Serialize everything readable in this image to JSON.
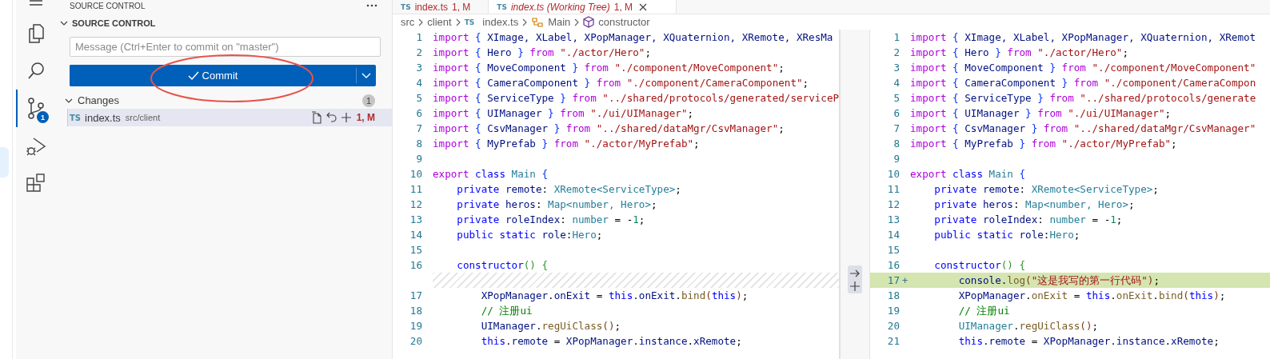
{
  "activity_bar": {
    "items": [
      {
        "kind": "menu",
        "selected": false
      },
      {
        "kind": "files",
        "selected": false
      },
      {
        "kind": "search",
        "selected": false
      },
      {
        "kind": "source-control",
        "selected": true,
        "badge": "1"
      },
      {
        "kind": "run-debug",
        "selected": false
      },
      {
        "kind": "extensions",
        "selected": false
      }
    ]
  },
  "sidebar": {
    "title": "SOURCE CONTROL",
    "section": {
      "label": "SOURCE CONTROL",
      "expanded": true
    },
    "message": {
      "placeholder": "Message (Ctrl+Enter to commit on \"master\")"
    },
    "commit_button": {
      "label": "Commit"
    },
    "annotation": {
      "kind": "ellipse"
    },
    "changes": {
      "label": "Changes",
      "expanded": true,
      "count": "1",
      "files": [
        {
          "file_type": "TS",
          "name": "index.ts",
          "path": "src/client",
          "status": "1, M",
          "selected": true
        }
      ]
    }
  },
  "editor": {
    "tabs": [
      {
        "file_type": "TS",
        "label": "index.ts",
        "status": "1, M",
        "selected": false,
        "preview": false
      },
      {
        "file_type": "TS",
        "label": "index.ts (Working Tree)",
        "status": "1, M",
        "selected": true,
        "preview": true
      }
    ],
    "breadcrumbs": [
      {
        "label": "src",
        "kind": "folder"
      },
      {
        "label": "client",
        "kind": "folder"
      },
      {
        "label": "index.ts",
        "kind": "ts-file",
        "file_type": "TS"
      },
      {
        "label": "Main",
        "kind": "class"
      },
      {
        "label": "constructor",
        "kind": "method"
      }
    ],
    "left_pane": {
      "lines": [
        {
          "kind": "line",
          "number": "1",
          "tokens": [
            {
              "kind": "k",
              "text": "import "
            },
            {
              "kind": "b1",
              "text": "{"
            },
            {
              "kind": "v",
              "text": " XImage, XLabel, XPopManager, XQuaternion, XRemote, XResMa"
            }
          ]
        },
        {
          "kind": "line",
          "number": "2",
          "tokens": [
            {
              "kind": "k",
              "text": "import "
            },
            {
              "kind": "b1",
              "text": "{"
            },
            {
              "kind": "v",
              "text": " Hero "
            },
            {
              "kind": "b1",
              "text": "}"
            },
            {
              "kind": "k",
              "text": " from "
            },
            {
              "kind": "s",
              "text": "\"./actor/Hero\""
            },
            {
              "kind": "p",
              "text": ";"
            }
          ]
        },
        {
          "kind": "line",
          "number": "3",
          "tokens": [
            {
              "kind": "k",
              "text": "import "
            },
            {
              "kind": "b1",
              "text": "{"
            },
            {
              "kind": "v",
              "text": " MoveComponent "
            },
            {
              "kind": "b1",
              "text": "}"
            },
            {
              "kind": "k",
              "text": " from "
            },
            {
              "kind": "s",
              "text": "\"./component/MoveComponent\""
            },
            {
              "kind": "p",
              "text": ";"
            }
          ]
        },
        {
          "kind": "line",
          "number": "4",
          "tokens": [
            {
              "kind": "k",
              "text": "import "
            },
            {
              "kind": "b1",
              "text": "{"
            },
            {
              "kind": "v",
              "text": " CameraComponent "
            },
            {
              "kind": "b1",
              "text": "}"
            },
            {
              "kind": "k",
              "text": " from "
            },
            {
              "kind": "s",
              "text": "\"./component/CameraComponent\""
            },
            {
              "kind": "p",
              "text": ";"
            }
          ]
        },
        {
          "kind": "line",
          "number": "5",
          "tokens": [
            {
              "kind": "k",
              "text": "import "
            },
            {
              "kind": "b1",
              "text": "{"
            },
            {
              "kind": "v",
              "text": " ServiceType "
            },
            {
              "kind": "b1",
              "text": "}"
            },
            {
              "kind": "k",
              "text": " from "
            },
            {
              "kind": "s",
              "text": "\"../shared/protocols/generated/serviceP"
            }
          ]
        },
        {
          "kind": "line",
          "number": "6",
          "tokens": [
            {
              "kind": "k",
              "text": "import "
            },
            {
              "kind": "b1",
              "text": "{"
            },
            {
              "kind": "v",
              "text": " UIManager "
            },
            {
              "kind": "b1",
              "text": "}"
            },
            {
              "kind": "k",
              "text": " from "
            },
            {
              "kind": "s",
              "text": "\"./ui/UIManager\""
            },
            {
              "kind": "p",
              "text": ";"
            }
          ]
        },
        {
          "kind": "line",
          "number": "7",
          "tokens": [
            {
              "kind": "k",
              "text": "import "
            },
            {
              "kind": "b1",
              "text": "{"
            },
            {
              "kind": "v",
              "text": " CsvManager "
            },
            {
              "kind": "b1",
              "text": "}"
            },
            {
              "kind": "k",
              "text": " from "
            },
            {
              "kind": "s",
              "text": "\"../shared/dataMgr/CsvManager\""
            },
            {
              "kind": "p",
              "text": ";"
            }
          ]
        },
        {
          "kind": "line",
          "number": "8",
          "tokens": [
            {
              "kind": "k",
              "text": "import "
            },
            {
              "kind": "b1",
              "text": "{"
            },
            {
              "kind": "v",
              "text": " MyPrefab "
            },
            {
              "kind": "b1",
              "text": "}"
            },
            {
              "kind": "k",
              "text": " from "
            },
            {
              "kind": "s",
              "text": "\"./actor/MyPrefab\""
            },
            {
              "kind": "p",
              "text": ";"
            }
          ]
        },
        {
          "kind": "line",
          "number": "9"
        },
        {
          "kind": "line",
          "number": "10",
          "tokens": [
            {
              "kind": "k",
              "text": "export "
            },
            {
              "kind": "b",
              "text": "class "
            },
            {
              "kind": "t",
              "text": "Main "
            },
            {
              "kind": "b1",
              "text": "{"
            }
          ]
        },
        {
          "kind": "line",
          "number": "11",
          "tokens": [
            {
              "kind": "b",
              "text": "    private "
            },
            {
              "kind": "v",
              "text": "remote"
            },
            {
              "kind": "p",
              "text": ": "
            },
            {
              "kind": "t",
              "text": "XRemote<ServiceType>"
            },
            {
              "kind": "p",
              "text": ";"
            }
          ]
        },
        {
          "kind": "line",
          "number": "12",
          "tokens": [
            {
              "kind": "b",
              "text": "    private "
            },
            {
              "kind": "v",
              "text": "heros"
            },
            {
              "kind": "p",
              "text": ": "
            },
            {
              "kind": "t",
              "text": "Map<number, Hero>"
            },
            {
              "kind": "p",
              "text": ";"
            }
          ]
        },
        {
          "kind": "line",
          "number": "13",
          "tokens": [
            {
              "kind": "b",
              "text": "    private "
            },
            {
              "kind": "v",
              "text": "roleIndex"
            },
            {
              "kind": "p",
              "text": ": "
            },
            {
              "kind": "t",
              "text": "number"
            },
            {
              "kind": "p",
              "text": " = -"
            },
            {
              "kind": "n",
              "text": "1"
            },
            {
              "kind": "p",
              "text": ";"
            }
          ]
        },
        {
          "kind": "line",
          "number": "14",
          "tokens": [
            {
              "kind": "b",
              "text": "    public static "
            },
            {
              "kind": "v",
              "text": "role"
            },
            {
              "kind": "p",
              "text": ":"
            },
            {
              "kind": "t",
              "text": "Hero"
            },
            {
              "kind": "p",
              "text": ";"
            }
          ]
        },
        {
          "kind": "line",
          "number": "15"
        },
        {
          "kind": "line",
          "number": "16",
          "tokens": [
            {
              "kind": "b",
              "text": "    constructor"
            },
            {
              "kind": "b2",
              "text": "() {"
            }
          ]
        },
        {
          "kind": "placeholder"
        },
        {
          "kind": "line",
          "number": "17",
          "tokens": [
            {
              "kind": "v",
              "text": "        XPopManager"
            },
            {
              "kind": "p",
              "text": "."
            },
            {
              "kind": "v",
              "text": "onExit"
            },
            {
              "kind": "p",
              "text": " = "
            },
            {
              "kind": "b",
              "text": "this"
            },
            {
              "kind": "p",
              "text": "."
            },
            {
              "kind": "v",
              "text": "onExit"
            },
            {
              "kind": "p",
              "text": "."
            },
            {
              "kind": "f",
              "text": "bind"
            },
            {
              "kind": "b3",
              "text": "("
            },
            {
              "kind": "b",
              "text": "this"
            },
            {
              "kind": "b3",
              "text": ")"
            },
            {
              "kind": "p",
              "text": ";"
            }
          ]
        },
        {
          "kind": "line",
          "number": "18",
          "tokens": [
            {
              "kind": "c",
              "text": "        // 注册ui"
            }
          ]
        },
        {
          "kind": "line",
          "number": "19",
          "tokens": [
            {
              "kind": "v",
              "text": "        UIManager"
            },
            {
              "kind": "p",
              "text": "."
            },
            {
              "kind": "f",
              "text": "regUiClass"
            },
            {
              "kind": "b3",
              "text": "()"
            },
            {
              "kind": "p",
              "text": ";"
            }
          ]
        },
        {
          "kind": "line",
          "number": "20",
          "tokens": [
            {
              "kind": "b",
              "text": "        this"
            },
            {
              "kind": "p",
              "text": "."
            },
            {
              "kind": "v",
              "text": "remote"
            },
            {
              "kind": "p",
              "text": " = "
            },
            {
              "kind": "v",
              "text": "XPopManager"
            },
            {
              "kind": "p",
              "text": "."
            },
            {
              "kind": "v",
              "text": "instance"
            },
            {
              "kind": "p",
              "text": "."
            },
            {
              "kind": "v",
              "text": "xRemote"
            },
            {
              "kind": "p",
              "text": ";"
            }
          ]
        }
      ]
    },
    "right_pane": {
      "lines": [
        {
          "kind": "line",
          "number": "1",
          "tokens": [
            {
              "kind": "k",
              "text": "import "
            },
            {
              "kind": "b1",
              "text": "{"
            },
            {
              "kind": "v",
              "text": " XImage, XLabel, XPopManager, XQuaternion, XRemot"
            }
          ]
        },
        {
          "kind": "line",
          "number": "2",
          "tokens": [
            {
              "kind": "k",
              "text": "import "
            },
            {
              "kind": "b1",
              "text": "{"
            },
            {
              "kind": "v",
              "text": " Hero "
            },
            {
              "kind": "b1",
              "text": "}"
            },
            {
              "kind": "k",
              "text": " from "
            },
            {
              "kind": "s",
              "text": "\"./actor/Hero\""
            },
            {
              "kind": "p",
              "text": ";"
            }
          ]
        },
        {
          "kind": "line",
          "number": "3",
          "tokens": [
            {
              "kind": "k",
              "text": "import "
            },
            {
              "kind": "b1",
              "text": "{"
            },
            {
              "kind": "v",
              "text": " MoveComponent "
            },
            {
              "kind": "b1",
              "text": "}"
            },
            {
              "kind": "k",
              "text": " from "
            },
            {
              "kind": "s",
              "text": "\"./component/MoveComponent\""
            }
          ]
        },
        {
          "kind": "line",
          "number": "4",
          "tokens": [
            {
              "kind": "k",
              "text": "import "
            },
            {
              "kind": "b1",
              "text": "{"
            },
            {
              "kind": "v",
              "text": " CameraComponent "
            },
            {
              "kind": "b1",
              "text": "}"
            },
            {
              "kind": "k",
              "text": " from "
            },
            {
              "kind": "s",
              "text": "\"./component/CameraCompon"
            }
          ]
        },
        {
          "kind": "line",
          "number": "5",
          "tokens": [
            {
              "kind": "k",
              "text": "import "
            },
            {
              "kind": "b1",
              "text": "{"
            },
            {
              "kind": "v",
              "text": " ServiceType "
            },
            {
              "kind": "b1",
              "text": "}"
            },
            {
              "kind": "k",
              "text": " from "
            },
            {
              "kind": "s",
              "text": "\"../shared/protocols/generate"
            }
          ]
        },
        {
          "kind": "line",
          "number": "6",
          "tokens": [
            {
              "kind": "k",
              "text": "import "
            },
            {
              "kind": "b1",
              "text": "{"
            },
            {
              "kind": "v",
              "text": " UIManager "
            },
            {
              "kind": "b1",
              "text": "}"
            },
            {
              "kind": "k",
              "text": " from "
            },
            {
              "kind": "s",
              "text": "\"./ui/UIManager\""
            },
            {
              "kind": "p",
              "text": ";"
            }
          ]
        },
        {
          "kind": "line",
          "number": "7",
          "tokens": [
            {
              "kind": "k",
              "text": "import "
            },
            {
              "kind": "b1",
              "text": "{"
            },
            {
              "kind": "v",
              "text": " CsvManager "
            },
            {
              "kind": "b1",
              "text": "}"
            },
            {
              "kind": "k",
              "text": " from "
            },
            {
              "kind": "s",
              "text": "\"../shared/dataMgr/CsvManager\""
            }
          ]
        },
        {
          "kind": "line",
          "number": "8",
          "tokens": [
            {
              "kind": "k",
              "text": "import "
            },
            {
              "kind": "b1",
              "text": "{"
            },
            {
              "kind": "v",
              "text": " MyPrefab "
            },
            {
              "kind": "b1",
              "text": "}"
            },
            {
              "kind": "k",
              "text": " from "
            },
            {
              "kind": "s",
              "text": "\"./actor/MyPrefab\""
            },
            {
              "kind": "p",
              "text": ";"
            }
          ]
        },
        {
          "kind": "line",
          "number": "9"
        },
        {
          "kind": "line",
          "number": "10",
          "tokens": [
            {
              "kind": "k",
              "text": "export "
            },
            {
              "kind": "b",
              "text": "class "
            },
            {
              "kind": "t",
              "text": "Main "
            },
            {
              "kind": "b1",
              "text": "{"
            }
          ]
        },
        {
          "kind": "line",
          "number": "11",
          "tokens": [
            {
              "kind": "b",
              "text": "    private "
            },
            {
              "kind": "v",
              "text": "remote"
            },
            {
              "kind": "p",
              "text": ": "
            },
            {
              "kind": "t",
              "text": "XRemote<ServiceType>"
            },
            {
              "kind": "p",
              "text": ";"
            }
          ]
        },
        {
          "kind": "line",
          "number": "12",
          "tokens": [
            {
              "kind": "b",
              "text": "    private "
            },
            {
              "kind": "v",
              "text": "heros"
            },
            {
              "kind": "p",
              "text": ": "
            },
            {
              "kind": "t",
              "text": "Map<number, Hero>"
            },
            {
              "kind": "p",
              "text": ";"
            }
          ]
        },
        {
          "kind": "line",
          "number": "13",
          "tokens": [
            {
              "kind": "b",
              "text": "    private "
            },
            {
              "kind": "v",
              "text": "roleIndex"
            },
            {
              "kind": "p",
              "text": ": "
            },
            {
              "kind": "t",
              "text": "number"
            },
            {
              "kind": "p",
              "text": " = -"
            },
            {
              "kind": "n",
              "text": "1"
            },
            {
              "kind": "p",
              "text": ";"
            }
          ]
        },
        {
          "kind": "line",
          "number": "14",
          "tokens": [
            {
              "kind": "b",
              "text": "    public static "
            },
            {
              "kind": "v",
              "text": "role"
            },
            {
              "kind": "p",
              "text": ":"
            },
            {
              "kind": "t",
              "text": "Hero"
            },
            {
              "kind": "p",
              "text": ";"
            }
          ]
        },
        {
          "kind": "line",
          "number": "15"
        },
        {
          "kind": "line",
          "number": "16",
          "tokens": [
            {
              "kind": "b",
              "text": "    constructor"
            },
            {
              "kind": "b2",
              "text": "() {"
            }
          ]
        },
        {
          "kind": "added",
          "number": "17",
          "marker": "+",
          "tokens": [
            {
              "kind": "v",
              "text": "        console"
            },
            {
              "kind": "p",
              "text": "."
            },
            {
              "kind": "f",
              "text": "log"
            },
            {
              "kind": "b3",
              "text": "("
            },
            {
              "kind": "s",
              "text": "\"这是我写的第一行代码\""
            },
            {
              "kind": "b3",
              "text": ")"
            },
            {
              "kind": "p",
              "text": ";"
            }
          ]
        },
        {
          "kind": "line",
          "number": "18",
          "tokens": [
            {
              "kind": "v",
              "text": "        XPopManager"
            },
            {
              "kind": "p",
              "text": "."
            },
            {
              "kind": "f",
              "text": "onExit"
            },
            {
              "kind": "p",
              "text": " = "
            },
            {
              "kind": "b",
              "text": "this"
            },
            {
              "kind": "p",
              "text": "."
            },
            {
              "kind": "f",
              "text": "onExit"
            },
            {
              "kind": "p",
              "text": "."
            },
            {
              "kind": "f",
              "text": "bind"
            },
            {
              "kind": "b3",
              "text": "("
            },
            {
              "kind": "b",
              "text": "this"
            },
            {
              "kind": "b3",
              "text": ")"
            },
            {
              "kind": "p",
              "text": ";"
            }
          ]
        },
        {
          "kind": "line",
          "number": "19",
          "tokens": [
            {
              "kind": "c",
              "text": "        // 注册ui"
            }
          ]
        },
        {
          "kind": "line",
          "number": "20",
          "tokens": [
            {
              "kind": "t",
              "text": "        UIManager"
            },
            {
              "kind": "p",
              "text": "."
            },
            {
              "kind": "f",
              "text": "regUiClass"
            },
            {
              "kind": "b3",
              "text": "()"
            },
            {
              "kind": "p",
              "text": ";"
            }
          ]
        },
        {
          "kind": "line",
          "number": "21",
          "tokens": [
            {
              "kind": "b",
              "text": "        this"
            },
            {
              "kind": "p",
              "text": "."
            },
            {
              "kind": "v",
              "text": "remote"
            },
            {
              "kind": "p",
              "text": " = "
            },
            {
              "kind": "v",
              "text": "XPopManager"
            },
            {
              "kind": "p",
              "text": "."
            },
            {
              "kind": "v",
              "text": "instance"
            },
            {
              "kind": "p",
              "text": "."
            },
            {
              "kind": "v",
              "text": "xRemote"
            },
            {
              "kind": "p",
              "text": ";"
            }
          ]
        }
      ]
    }
  }
}
